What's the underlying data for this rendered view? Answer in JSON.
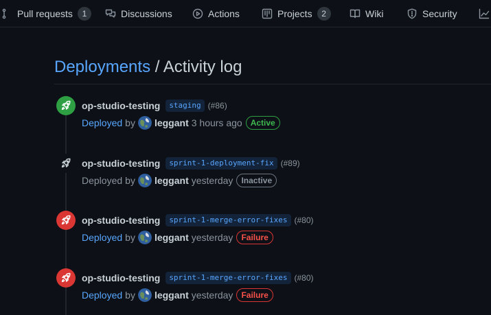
{
  "nav": {
    "tabs": [
      {
        "label": "Pull requests",
        "icon": "git-pull-request-icon",
        "count": "1"
      },
      {
        "label": "Discussions",
        "icon": "comment-discussion-icon"
      },
      {
        "label": "Actions",
        "icon": "play-icon"
      },
      {
        "label": "Projects",
        "icon": "table-icon",
        "count": "2"
      },
      {
        "label": "Wiki",
        "icon": "book-icon"
      },
      {
        "label": "Security",
        "icon": "shield-icon"
      }
    ]
  },
  "heading": {
    "link": "Deployments",
    "separator": " / ",
    "title": "Activity log"
  },
  "colors": {
    "background": "#0d1117",
    "link": "#58a6ff",
    "success": "#2ea043",
    "failure": "#da3633"
  },
  "deployments": [
    {
      "environment": "op-studio-testing",
      "ref": "staging",
      "number": "(#86)",
      "state": "success",
      "status_text": "Deployed",
      "by": "by",
      "user": "leggant",
      "when": "3 hours ago",
      "badge": "Active"
    },
    {
      "environment": "op-studio-testing",
      "ref": "sprint-1-deployment-fix",
      "number": "(#89)",
      "state": "neutral",
      "status_text": "Deployed",
      "by": "by",
      "user": "leggant",
      "when": "yesterday",
      "badge": "Inactive"
    },
    {
      "environment": "op-studio-testing",
      "ref": "sprint-1-merge-error-fixes",
      "number": "(#80)",
      "state": "failure",
      "status_text": "Deployed",
      "by": "by",
      "user": "leggant",
      "when": "yesterday",
      "badge": "Failure"
    },
    {
      "environment": "op-studio-testing",
      "ref": "sprint-1-merge-error-fixes",
      "number": "(#80)",
      "state": "failure",
      "status_text": "Deployed",
      "by": "by",
      "user": "leggant",
      "when": "yesterday",
      "badge": "Failure"
    }
  ]
}
